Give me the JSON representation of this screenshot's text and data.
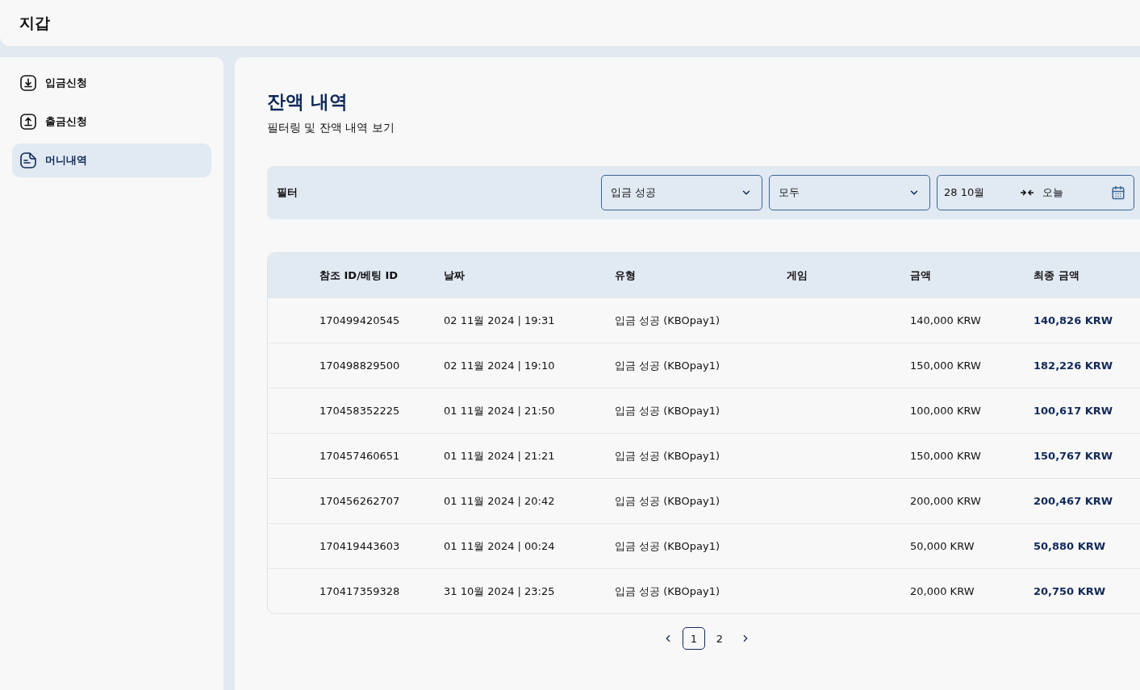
{
  "header": {
    "title": "지갑"
  },
  "sidebar": {
    "items": [
      {
        "label": "입금신청",
        "kind": "download",
        "selected": false
      },
      {
        "label": "출금신청",
        "kind": "upload",
        "selected": false
      },
      {
        "label": "머니내역",
        "kind": "document",
        "selected": true
      }
    ]
  },
  "page": {
    "title": "잔액 내역",
    "subtitle": "필터링 및 잔액 내역 보기"
  },
  "filter": {
    "label": "필터",
    "selects": [
      {
        "value": "입금 성공"
      },
      {
        "value": "모두"
      }
    ],
    "date_range": {
      "from": "28 10월",
      "to": "오늘"
    }
  },
  "table": {
    "columns": [
      "참조 ID/베팅 ID",
      "날짜",
      "유형",
      "게임",
      "금액",
      "최종 금액"
    ],
    "rows": [
      [
        "170499420545",
        "02 11월 2024 | 19:31",
        "입금 성공 (KBOpay1)",
        "",
        "140,000 KRW",
        "140,826 KRW"
      ],
      [
        "170498829500",
        "02 11월 2024 | 19:10",
        "입금 성공 (KBOpay1)",
        "",
        "150,000 KRW",
        "182,226 KRW"
      ],
      [
        "170458352225",
        "01 11월 2024 | 21:50",
        "입금 성공 (KBOpay1)",
        "",
        "100,000 KRW",
        "100,617 KRW"
      ],
      [
        "170457460651",
        "01 11월 2024 | 21:21",
        "입금 성공 (KBOpay1)",
        "",
        "150,000 KRW",
        "150,767 KRW"
      ],
      [
        "170456262707",
        "01 11월 2024 | 20:42",
        "입금 성공 (KBOpay1)",
        "",
        "200,000 KRW",
        "200,467 KRW"
      ],
      [
        "170419443603",
        "01 11월 2024 | 00:24",
        "입금 성공 (KBOpay1)",
        "",
        "50,000 KRW",
        "50,880 KRW"
      ],
      [
        "170417359328",
        "31 10월 2024 | 23:25",
        "입금 성공 (KBOpay1)",
        "",
        "20,000 KRW",
        "20,750 KRW"
      ]
    ]
  },
  "pagination": {
    "pages": [
      {
        "label": "1",
        "selected": true
      },
      {
        "label": "2",
        "selected": false
      }
    ]
  }
}
